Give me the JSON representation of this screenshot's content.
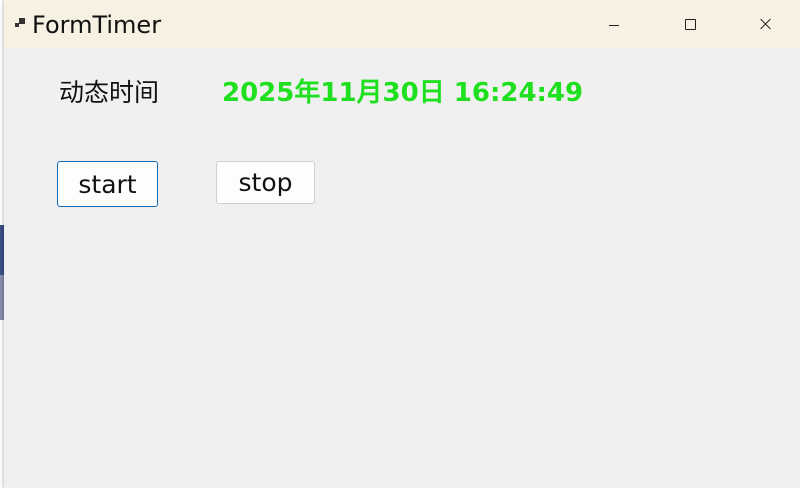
{
  "window": {
    "title": "FormTimer"
  },
  "content": {
    "label": "动态时间",
    "time_value": "2025年11月30日 16:24:49",
    "time_color": "#1ee01e"
  },
  "buttons": {
    "start_label": "start",
    "stop_label": "stop"
  }
}
